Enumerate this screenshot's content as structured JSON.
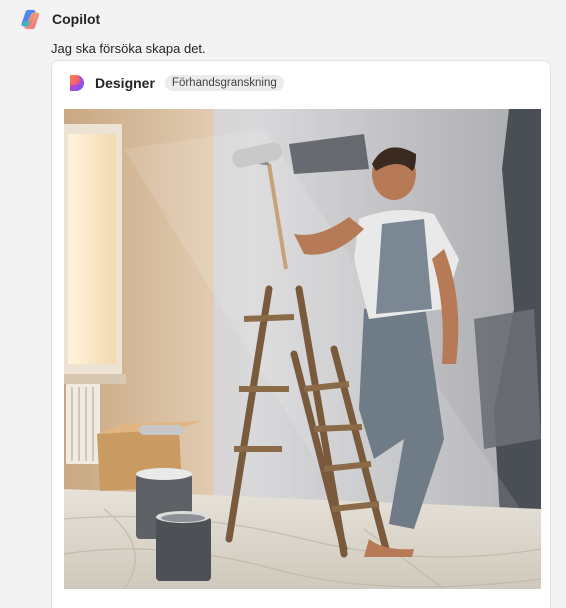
{
  "assistant": {
    "name": "Copilot",
    "message": "Jag ska försöka skapa det."
  },
  "card": {
    "title": "Designer",
    "badge": "Förhandsgranskning"
  },
  "image": {
    "subject": "man painting wall on ladder",
    "icon": "generated-image"
  },
  "colors": {
    "page_bg": "#f3f3f3",
    "card_bg": "#ffffff",
    "badge_bg": "#ececec"
  }
}
